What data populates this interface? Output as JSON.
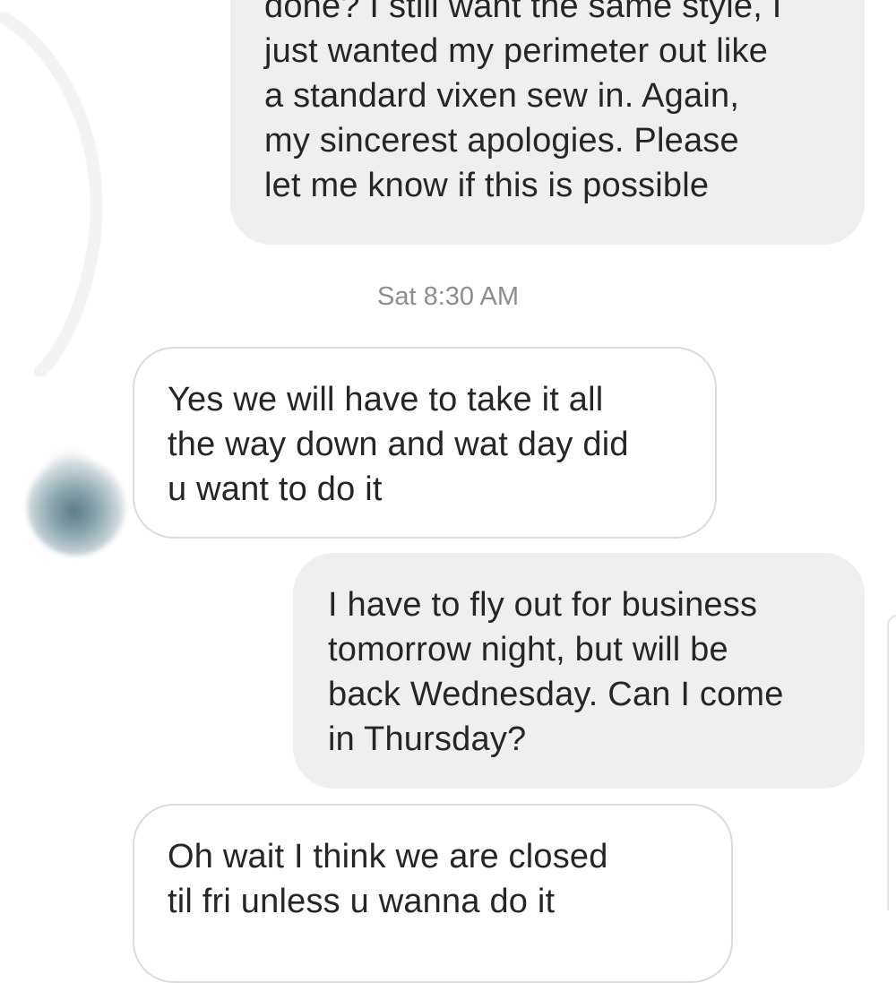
{
  "thread": {
    "messages": [
      {
        "id": "msg-1",
        "direction": "sent",
        "text": "done? I still want the same style, I\njust wanted my perimeter out like\na standard vixen sew in. Again,\nmy sincerest apologies. Please\nlet me know if this is possible"
      },
      {
        "id": "msg-2",
        "direction": "received",
        "text": "Yes we will have to take it all\nthe way down and wat day did\nu want to do it"
      },
      {
        "id": "msg-3",
        "direction": "sent",
        "text": "I have to fly out for business\ntomorrow night, but will be\nback Wednesday. Can I come\nin Thursday?"
      },
      {
        "id": "msg-4",
        "direction": "received",
        "text": "Oh wait I think we are closed\ntil fri unless u wanna do it"
      }
    ],
    "timestamp": "Sat 8:30 AM",
    "avatar": {
      "icon": "blurred-profile-avatar"
    }
  },
  "colors": {
    "sent_bubble": "#efefef",
    "received_bubble_border": "#dbdbdb",
    "text": "#262626",
    "timestamp": "#8e8e8e"
  }
}
